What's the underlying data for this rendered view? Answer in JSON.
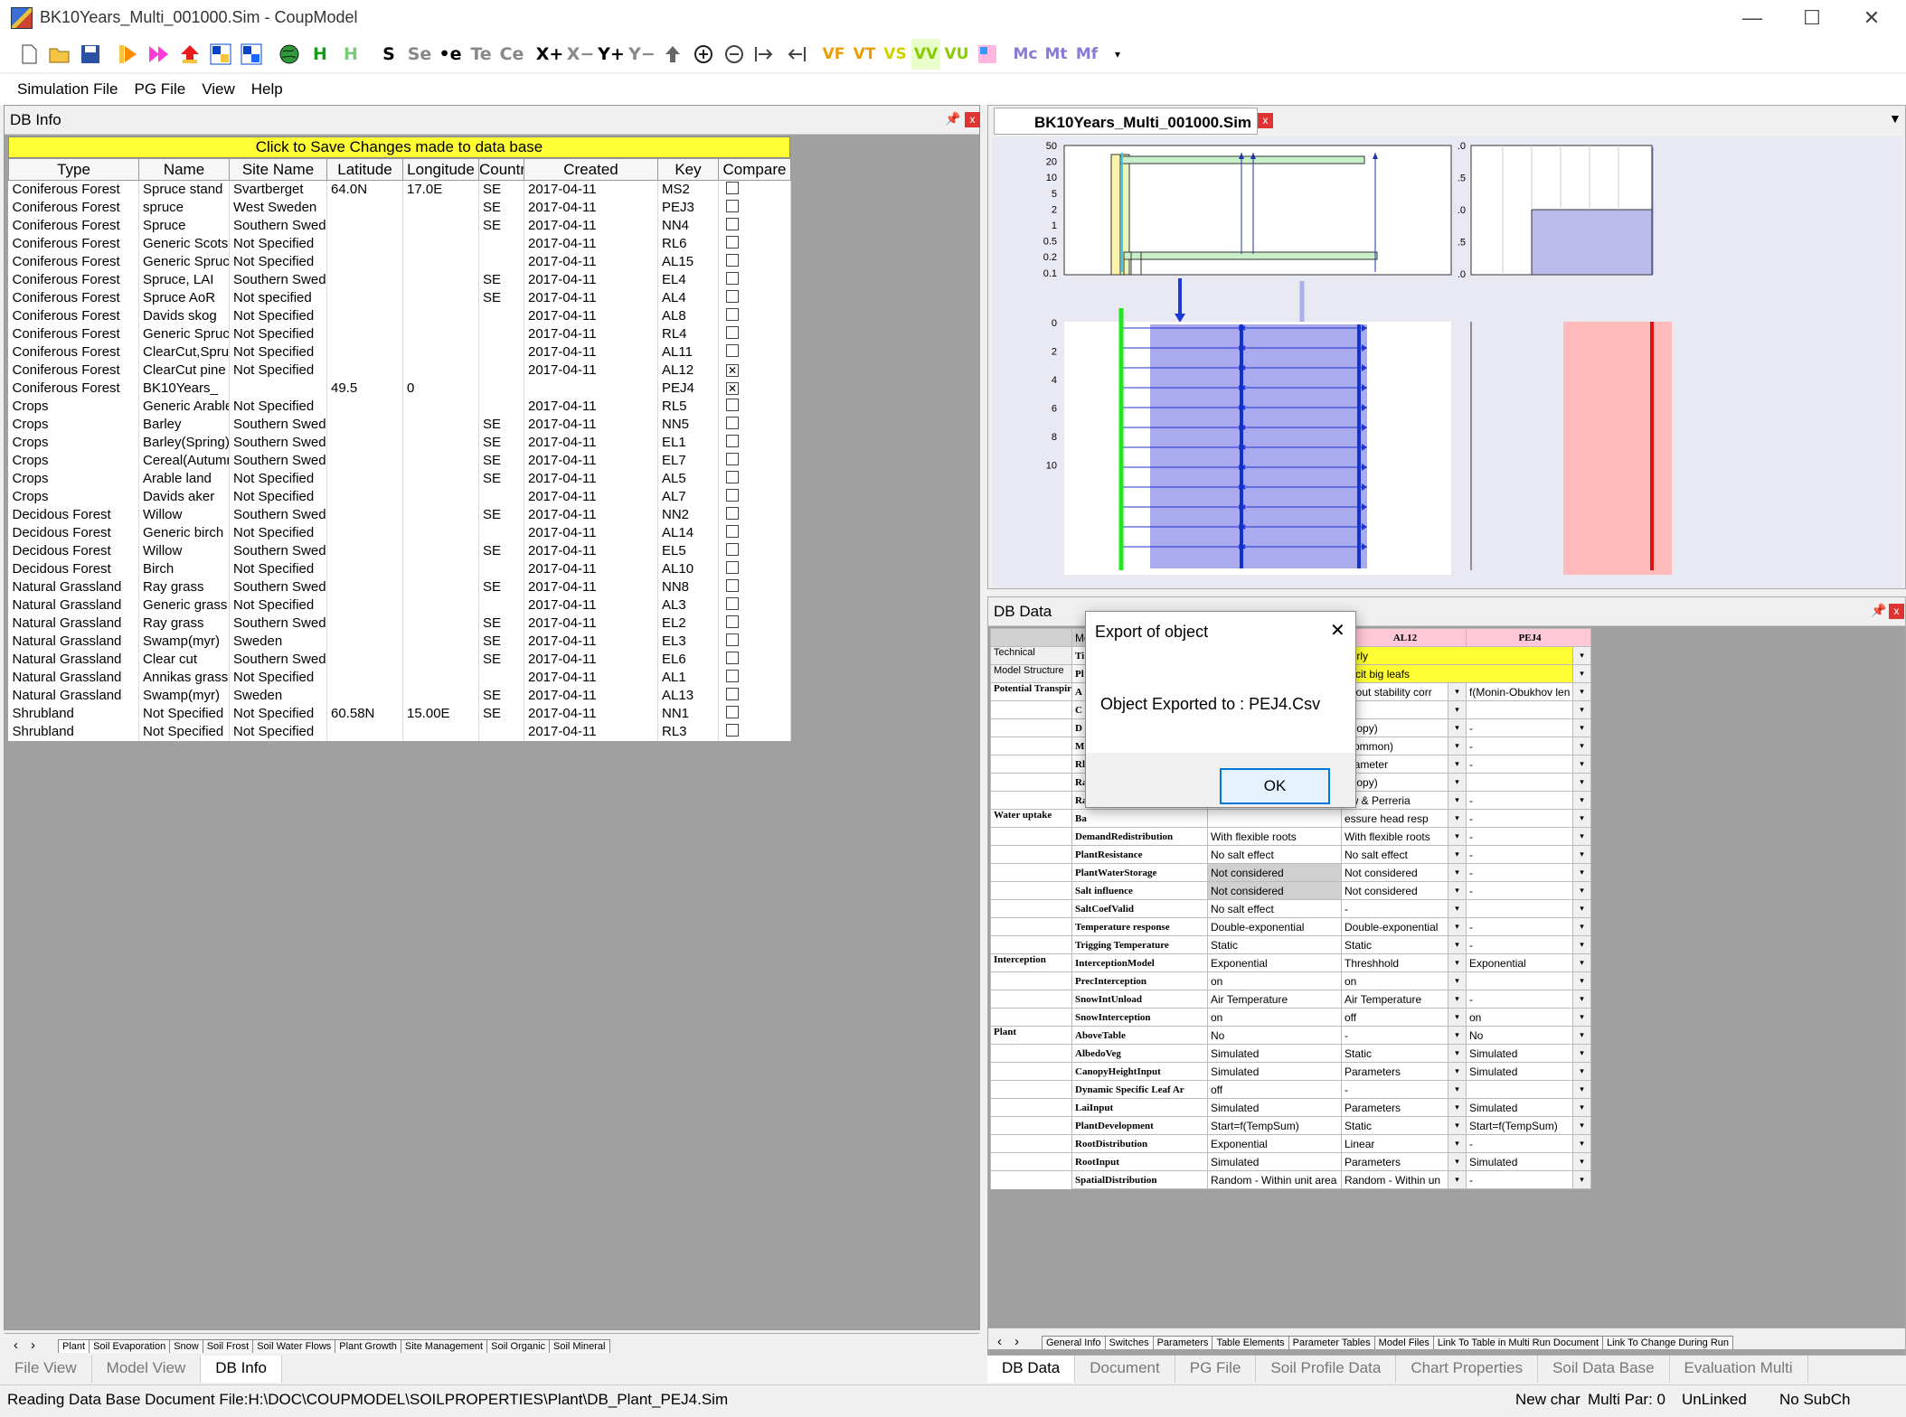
{
  "window": {
    "title": "BK10Years_Multi_001000.Sim - CoupModel",
    "minimize": "—",
    "maximize": "☐",
    "close": "✕"
  },
  "toolbar": [
    "new-file-icon",
    "open-folder-icon",
    "save-icon",
    "run-icon",
    "run-multi-icon",
    "up-arrow-icon",
    "pg-icon",
    "pg2-icon",
    "globe-icon",
    "H",
    "H",
    "S",
    "Se",
    "Te",
    "Ce",
    "X+",
    "X−",
    "Y+",
    "Y−",
    "up-icon",
    "zoom-in-icon",
    "zoom-out-icon",
    "move-right-icon",
    "move-left-icon",
    "VF",
    "VT",
    "VS",
    "VV",
    "VU",
    "chart-icon",
    "Mc",
    "Mt",
    "Mf",
    "dropdown-icon"
  ],
  "toolbar_labels": {
    "s": "S",
    "se": "Se",
    "e": "•e",
    "te": "Te",
    "ce": "Ce",
    "xp": "X+",
    "xm": "X−",
    "yp": "Y+",
    "ym": "Y−",
    "vf": "VF",
    "vt": "VT",
    "vs": "VS",
    "vv": "VV",
    "vu": "VU",
    "mc": "Mc",
    "mt": "Mt",
    "mf": "Mf",
    "h1": "H",
    "h2": "H"
  },
  "menu": [
    "Simulation File",
    "PG File",
    "View",
    "Help"
  ],
  "left_panel": {
    "title": "DB Info",
    "banner": "Click to Save Changes made to data base",
    "columns": [
      "Type",
      "Name",
      "Site Name",
      "Latitude",
      "Longitude",
      "Countr",
      "Created",
      "Key",
      "Compare"
    ],
    "rows": [
      [
        "Coniferous Forest",
        "Spruce stand",
        "Svartberget",
        "64.0N",
        "17.0E",
        "SE",
        "2017-04-11",
        "MS2",
        false
      ],
      [
        "Coniferous Forest",
        "spruce",
        "West Sweden",
        "",
        "",
        "SE",
        "2017-04-11",
        "PEJ3",
        false
      ],
      [
        "Coniferous Forest",
        "Spruce",
        "Southern Sweden",
        "",
        "",
        "SE",
        "2017-04-11",
        "NN4",
        false
      ],
      [
        "Coniferous Forest",
        "Generic Scots",
        "Not Specified",
        "",
        "",
        "",
        "2017-04-11",
        "RL6",
        false
      ],
      [
        "Coniferous Forest",
        "Generic Spruce",
        "Not Specified",
        "",
        "",
        "",
        "2017-04-11",
        "AL15",
        false
      ],
      [
        "Coniferous Forest",
        "Spruce, LAI",
        "Southern Sweden",
        "",
        "",
        "SE",
        "2017-04-11",
        "EL4",
        false
      ],
      [
        "Coniferous Forest",
        "Spruce AoR",
        "Not specified",
        "",
        "",
        "SE",
        "2017-04-11",
        "AL4",
        false
      ],
      [
        "Coniferous Forest",
        "Davids skog",
        "Not Specified",
        "",
        "",
        "",
        "2017-04-11",
        "AL8",
        false
      ],
      [
        "Coniferous Forest",
        "Generic Spruce",
        "Not Specified",
        "",
        "",
        "",
        "2017-04-11",
        "RL4",
        false
      ],
      [
        "Coniferous Forest",
        "ClearCut,Spruce",
        "Not Specified",
        "",
        "",
        "",
        "2017-04-11",
        "AL11",
        false
      ],
      [
        "Coniferous Forest",
        "ClearCut pine",
        "Not Specified",
        "",
        "",
        "",
        "2017-04-11",
        "AL12",
        true
      ],
      [
        "Coniferous Forest",
        "BK10Years_",
        "",
        "49.5",
        "0",
        "",
        "",
        "PEJ4",
        true
      ],
      [
        "Crops",
        "Generic Arable",
        "Not Specified",
        "",
        "",
        "",
        "2017-04-11",
        "RL5",
        false
      ],
      [
        "Crops",
        "Barley",
        "Southern Sweden",
        "",
        "",
        "SE",
        "2017-04-11",
        "NN5",
        false
      ],
      [
        "Crops",
        "Barley(Spring)",
        "Southern Sweden",
        "",
        "",
        "SE",
        "2017-04-11",
        "EL1",
        false
      ],
      [
        "Crops",
        "Cereal(Autumn)",
        "Southern Sweden",
        "",
        "",
        "SE",
        "2017-04-11",
        "EL7",
        false
      ],
      [
        "Crops",
        "Arable land",
        "Not Specified",
        "",
        "",
        "SE",
        "2017-04-11",
        "AL5",
        false
      ],
      [
        "Crops",
        "Davids aker",
        "Not Specified",
        "",
        "",
        "",
        "2017-04-11",
        "AL7",
        false
      ],
      [
        "Decidous Forest",
        "Willow",
        "Southern Sweden",
        "",
        "",
        "SE",
        "2017-04-11",
        "NN2",
        false
      ],
      [
        "Decidous Forest",
        "Generic birch",
        "Not Specified",
        "",
        "",
        "",
        "2017-04-11",
        "AL14",
        false
      ],
      [
        "Decidous Forest",
        "Willow",
        "Southern Sweden",
        "",
        "",
        "SE",
        "2017-04-11",
        "EL5",
        false
      ],
      [
        "Decidous Forest",
        "Birch",
        "Not Specified",
        "",
        "",
        "",
        "2017-04-11",
        "AL10",
        false
      ],
      [
        "Natural Grassland",
        "Ray grass",
        "Southern Sweden",
        "",
        "",
        "SE",
        "2017-04-11",
        "NN8",
        false
      ],
      [
        "Natural Grassland",
        "Generic grass",
        "Not Specified",
        "",
        "",
        "",
        "2017-04-11",
        "AL3",
        false
      ],
      [
        "Natural Grassland",
        "Ray grass",
        "Southern Sweden",
        "",
        "",
        "SE",
        "2017-04-11",
        "EL2",
        false
      ],
      [
        "Natural Grassland",
        "Swamp(myr)",
        "Sweden",
        "",
        "",
        "SE",
        "2017-04-11",
        "EL3",
        false
      ],
      [
        "Natural Grassland",
        "Clear cut",
        "Southern Sweden",
        "",
        "",
        "SE",
        "2017-04-11",
        "EL6",
        false
      ],
      [
        "Natural Grassland",
        "Annikas grass",
        "Not Specified",
        "",
        "",
        "",
        "2017-04-11",
        "AL1",
        false
      ],
      [
        "Natural Grassland",
        "Swamp(myr)",
        "Sweden",
        "",
        "",
        "SE",
        "2017-04-11",
        "AL13",
        false
      ],
      [
        "Shrubland",
        "Not Specified",
        "Not Specified",
        "60.58N",
        "15.00E",
        "SE",
        "2017-04-11",
        "NN1",
        false
      ],
      [
        "Shrubland",
        "Not Specified",
        "Not Specified",
        "",
        "",
        "",
        "2017-04-11",
        "RL3",
        false
      ]
    ],
    "subtabs": [
      "Plant",
      "Soil Evaporation",
      "Snow",
      "Soil Frost",
      "Soil Water Flows",
      "Plant Growth",
      "Site Management",
      "Soil Organic",
      "Soil Mineral"
    ]
  },
  "left_bottom_tabs": [
    "File View",
    "Model View",
    "DB Info"
  ],
  "right_top": {
    "doc_tab": "BK10Years_Multi_001000.Sim",
    "axis_top": [
      "50",
      "20",
      "10",
      "5",
      "2",
      "1",
      "0.5",
      "0.2",
      "0.1"
    ],
    "axis_bottom": [
      "0",
      "2",
      "4",
      "6",
      "8",
      "10"
    ],
    "axis_right": [
      ".0",
      ".5",
      ".0",
      ".5",
      ".0"
    ]
  },
  "right_bottom": {
    "title": "DB Data",
    "col_headers": [
      "AL12",
      "PEJ4"
    ],
    "model_col": "Mo",
    "groups": [
      {
        "cat": "Technical",
        "rows": [
          {
            "sw": "Ti",
            "v1": "",
            "v2": "ourly",
            "v3": "",
            "yellow": true
          }
        ]
      },
      {
        "cat": "Model Structure",
        "rows": [
          {
            "sw": "Pl",
            "v1": "",
            "v2": "plicit big leafs",
            "v3": "",
            "yellow": true
          }
        ]
      },
      {
        "cat": "Potential Transpiration",
        "rows": [
          {
            "sw": "A",
            "v1": "",
            "v2": "ithout stability corr",
            "v3": "f(Monin-Obukhov len"
          },
          {
            "sw": "C",
            "v1": "",
            "v2": "",
            "v3": ""
          },
          {
            "sw": "D",
            "v1": "",
            "v2": "anopy)",
            "v3": "-"
          },
          {
            "sw": "M",
            "v1": "",
            "v2": "(common)",
            "v3": "-"
          },
          {
            "sw": "Rl",
            "v1": "",
            "v2": "arameter",
            "v3": "-"
          },
          {
            "sw": "Ra",
            "v1": "",
            "v2": "anopy)",
            "v3": ""
          },
          {
            "sw": "Ra",
            "v1": "",
            "v2": "aw & Perreria",
            "v3": "-"
          }
        ]
      },
      {
        "cat": "Water uptake",
        "rows": [
          {
            "sw": "Ba",
            "v1": "",
            "v2": "essure head resp",
            "v3": "-"
          },
          {
            "sw": "DemandRedistribution",
            "v1": "With flexible roots",
            "v2": "With flexible roots",
            "v3": "-"
          },
          {
            "sw": "PlantResistance",
            "v1": "No salt effect",
            "v2": "No salt effect",
            "v3": "-"
          },
          {
            "sw": "PlantWaterStorage",
            "v1": "Not considered",
            "v2": "Not considered",
            "v3": "-"
          },
          {
            "sw": "Salt influence",
            "v1": "Not considered",
            "v2": "Not considered",
            "v3": "-"
          },
          {
            "sw": "SaltCoefValid",
            "v1": "No salt effect",
            "v2": "-",
            "v3": ""
          },
          {
            "sw": "Temperature response",
            "v1": "Double-exponential",
            "v2": "Double-exponential",
            "v3": "-"
          },
          {
            "sw": "Trigging Temperature",
            "v1": "Static",
            "v2": "Static",
            "v3": "-"
          }
        ]
      },
      {
        "cat": "Interception",
        "rows": [
          {
            "sw": "InterceptionModel",
            "v1": "Exponential",
            "v2": "Threshhold",
            "v3": "Exponential"
          },
          {
            "sw": "PrecInterception",
            "v1": "on",
            "v2": "on",
            "v3": ""
          },
          {
            "sw": "SnowIntUnload",
            "v1": "Air Temperature",
            "v2": "Air Temperature",
            "v3": "-"
          },
          {
            "sw": "SnowInterception",
            "v1": "on",
            "v2": "off",
            "v3": "on"
          }
        ]
      },
      {
        "cat": "Plant",
        "rows": [
          {
            "sw": "AboveTable",
            "v1": "No",
            "v2": "-",
            "v3": "No"
          },
          {
            "sw": "AlbedoVeg",
            "v1": "Simulated",
            "v2": "Static",
            "v3": "Simulated"
          },
          {
            "sw": "CanopyHeightInput",
            "v1": "Simulated",
            "v2": "Parameters",
            "v3": "Simulated"
          },
          {
            "sw": "Dynamic Specific Leaf Ar",
            "v1": "off",
            "v2": "-",
            "v3": ""
          },
          {
            "sw": "LaiInput",
            "v1": "Simulated",
            "v2": "Parameters",
            "v3": "Simulated"
          },
          {
            "sw": "PlantDevelopment",
            "v1": "Start=f(TempSum)",
            "v2": "Static",
            "v3": "Start=f(TempSum)"
          },
          {
            "sw": "RootDistribution",
            "v1": "Exponential",
            "v2": "Linear",
            "v3": "-"
          },
          {
            "sw": "RootInput",
            "v1": "Simulated",
            "v2": "Parameters",
            "v3": "Simulated"
          },
          {
            "sw": "SpatialDistribution",
            "v1": "Random - Within unit area",
            "v2": "Random - Within un",
            "v3": "-"
          }
        ]
      }
    ],
    "subtabs": [
      "General Info",
      "Switches",
      "Parameters",
      "Table Elements",
      "Parameter Tables",
      "Model Files",
      "Link To Table in Multi Run Document",
      "Link To Change During Run"
    ]
  },
  "right_bottom_tabs": [
    "DB Data",
    "Document",
    "PG File",
    "Soil Profile Data",
    "Chart Properties",
    "Soil Data Base",
    "Evaluation Multi"
  ],
  "dialog": {
    "title": "Export of object",
    "message": "Object Exported to : PEJ4.Csv",
    "ok": "OK",
    "close": "✕"
  },
  "status": {
    "left": "Reading Data Base Document File:H:\\DOC\\COUPMODEL\\SOILPROPERTIES\\Plant\\DB_Plant_PEJ4.Sim",
    "chart": "New char",
    "multi": "Multi Par: 0",
    "link": "UnLinked",
    "sub": "No SubCh"
  },
  "colors": {
    "banner": "#ffff33",
    "compare_header": "#ffc8d8",
    "dialog_button_border": "#0078d7"
  }
}
